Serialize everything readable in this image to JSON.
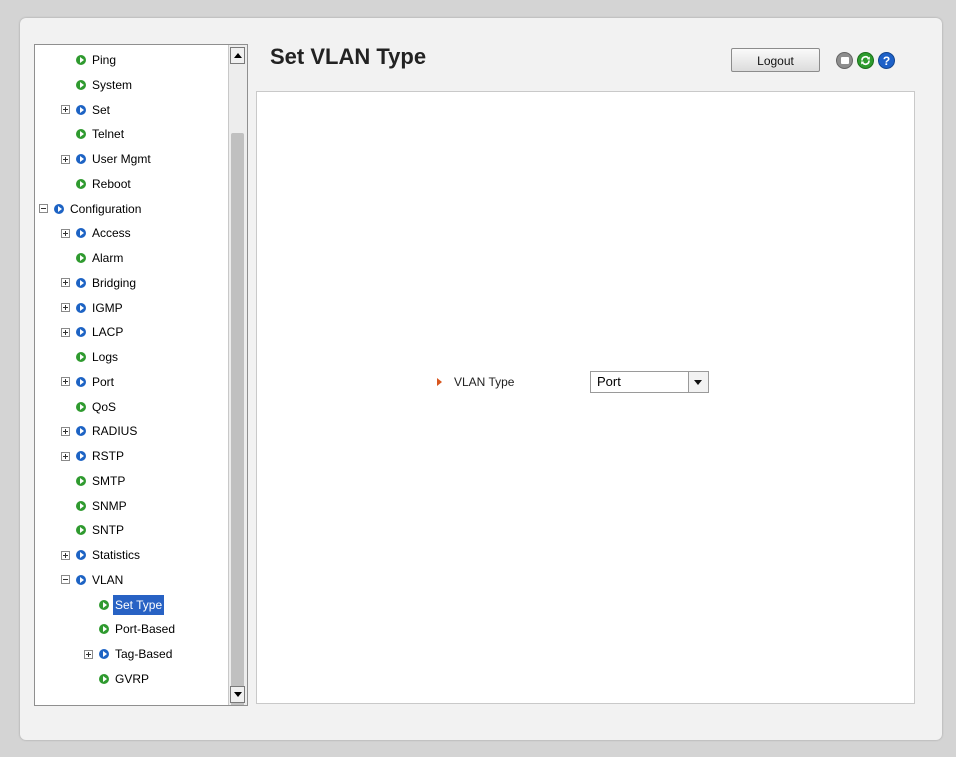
{
  "page": {
    "title": "Set VLAN Type",
    "logout_label": "Logout",
    "icons": {
      "save": "save-icon",
      "refresh": "refresh-icon",
      "help": "help-icon"
    }
  },
  "tree": {
    "items": [
      {
        "label": "Ping",
        "color": "green",
        "expander": "none",
        "level": 2
      },
      {
        "label": "System",
        "color": "green",
        "expander": "none",
        "level": 2
      },
      {
        "label": "Set",
        "color": "blue",
        "expander": "plus",
        "level": 2
      },
      {
        "label": "Telnet",
        "color": "green",
        "expander": "none",
        "level": 2
      },
      {
        "label": "User Mgmt",
        "color": "blue",
        "expander": "plus",
        "level": 2
      },
      {
        "label": "Reboot",
        "color": "green",
        "expander": "none",
        "level": 2
      },
      {
        "label": "Configuration",
        "color": "blue",
        "expander": "minus",
        "level": 1
      },
      {
        "label": "Access",
        "color": "blue",
        "expander": "plus",
        "level": 2
      },
      {
        "label": "Alarm",
        "color": "green",
        "expander": "none",
        "level": 2
      },
      {
        "label": "Bridging",
        "color": "blue",
        "expander": "plus",
        "level": 2
      },
      {
        "label": "IGMP",
        "color": "blue",
        "expander": "plus",
        "level": 2
      },
      {
        "label": "LACP",
        "color": "blue",
        "expander": "plus",
        "level": 2
      },
      {
        "label": "Logs",
        "color": "green",
        "expander": "none",
        "level": 2
      },
      {
        "label": "Port",
        "color": "blue",
        "expander": "plus",
        "level": 2
      },
      {
        "label": "QoS",
        "color": "green",
        "expander": "none",
        "level": 2
      },
      {
        "label": "RADIUS",
        "color": "blue",
        "expander": "plus",
        "level": 2
      },
      {
        "label": "RSTP",
        "color": "blue",
        "expander": "plus",
        "level": 2
      },
      {
        "label": "SMTP",
        "color": "green",
        "expander": "none",
        "level": 2
      },
      {
        "label": "SNMP",
        "color": "green",
        "expander": "none",
        "level": 2
      },
      {
        "label": "SNTP",
        "color": "green",
        "expander": "none",
        "level": 2
      },
      {
        "label": "Statistics",
        "color": "blue",
        "expander": "plus",
        "level": 2
      },
      {
        "label": "VLAN",
        "color": "blue",
        "expander": "minus",
        "level": 2
      },
      {
        "label": "Set Type",
        "color": "green",
        "expander": "none",
        "level": 3,
        "selected": true
      },
      {
        "label": "Port-Based",
        "color": "green",
        "expander": "none",
        "level": 3
      },
      {
        "label": "Tag-Based",
        "color": "blue",
        "expander": "plus",
        "level": 3
      },
      {
        "label": "GVRP",
        "color": "green",
        "expander": "none",
        "level": 3
      }
    ]
  },
  "form": {
    "vlan_type_label": "VLAN Type",
    "vlan_type_value": "Port"
  },
  "colors": {
    "green_bullet": "#2f9a2f",
    "blue_bullet": "#1d63c4",
    "selection": "#2862c4",
    "field_marker": "#d8561e"
  }
}
